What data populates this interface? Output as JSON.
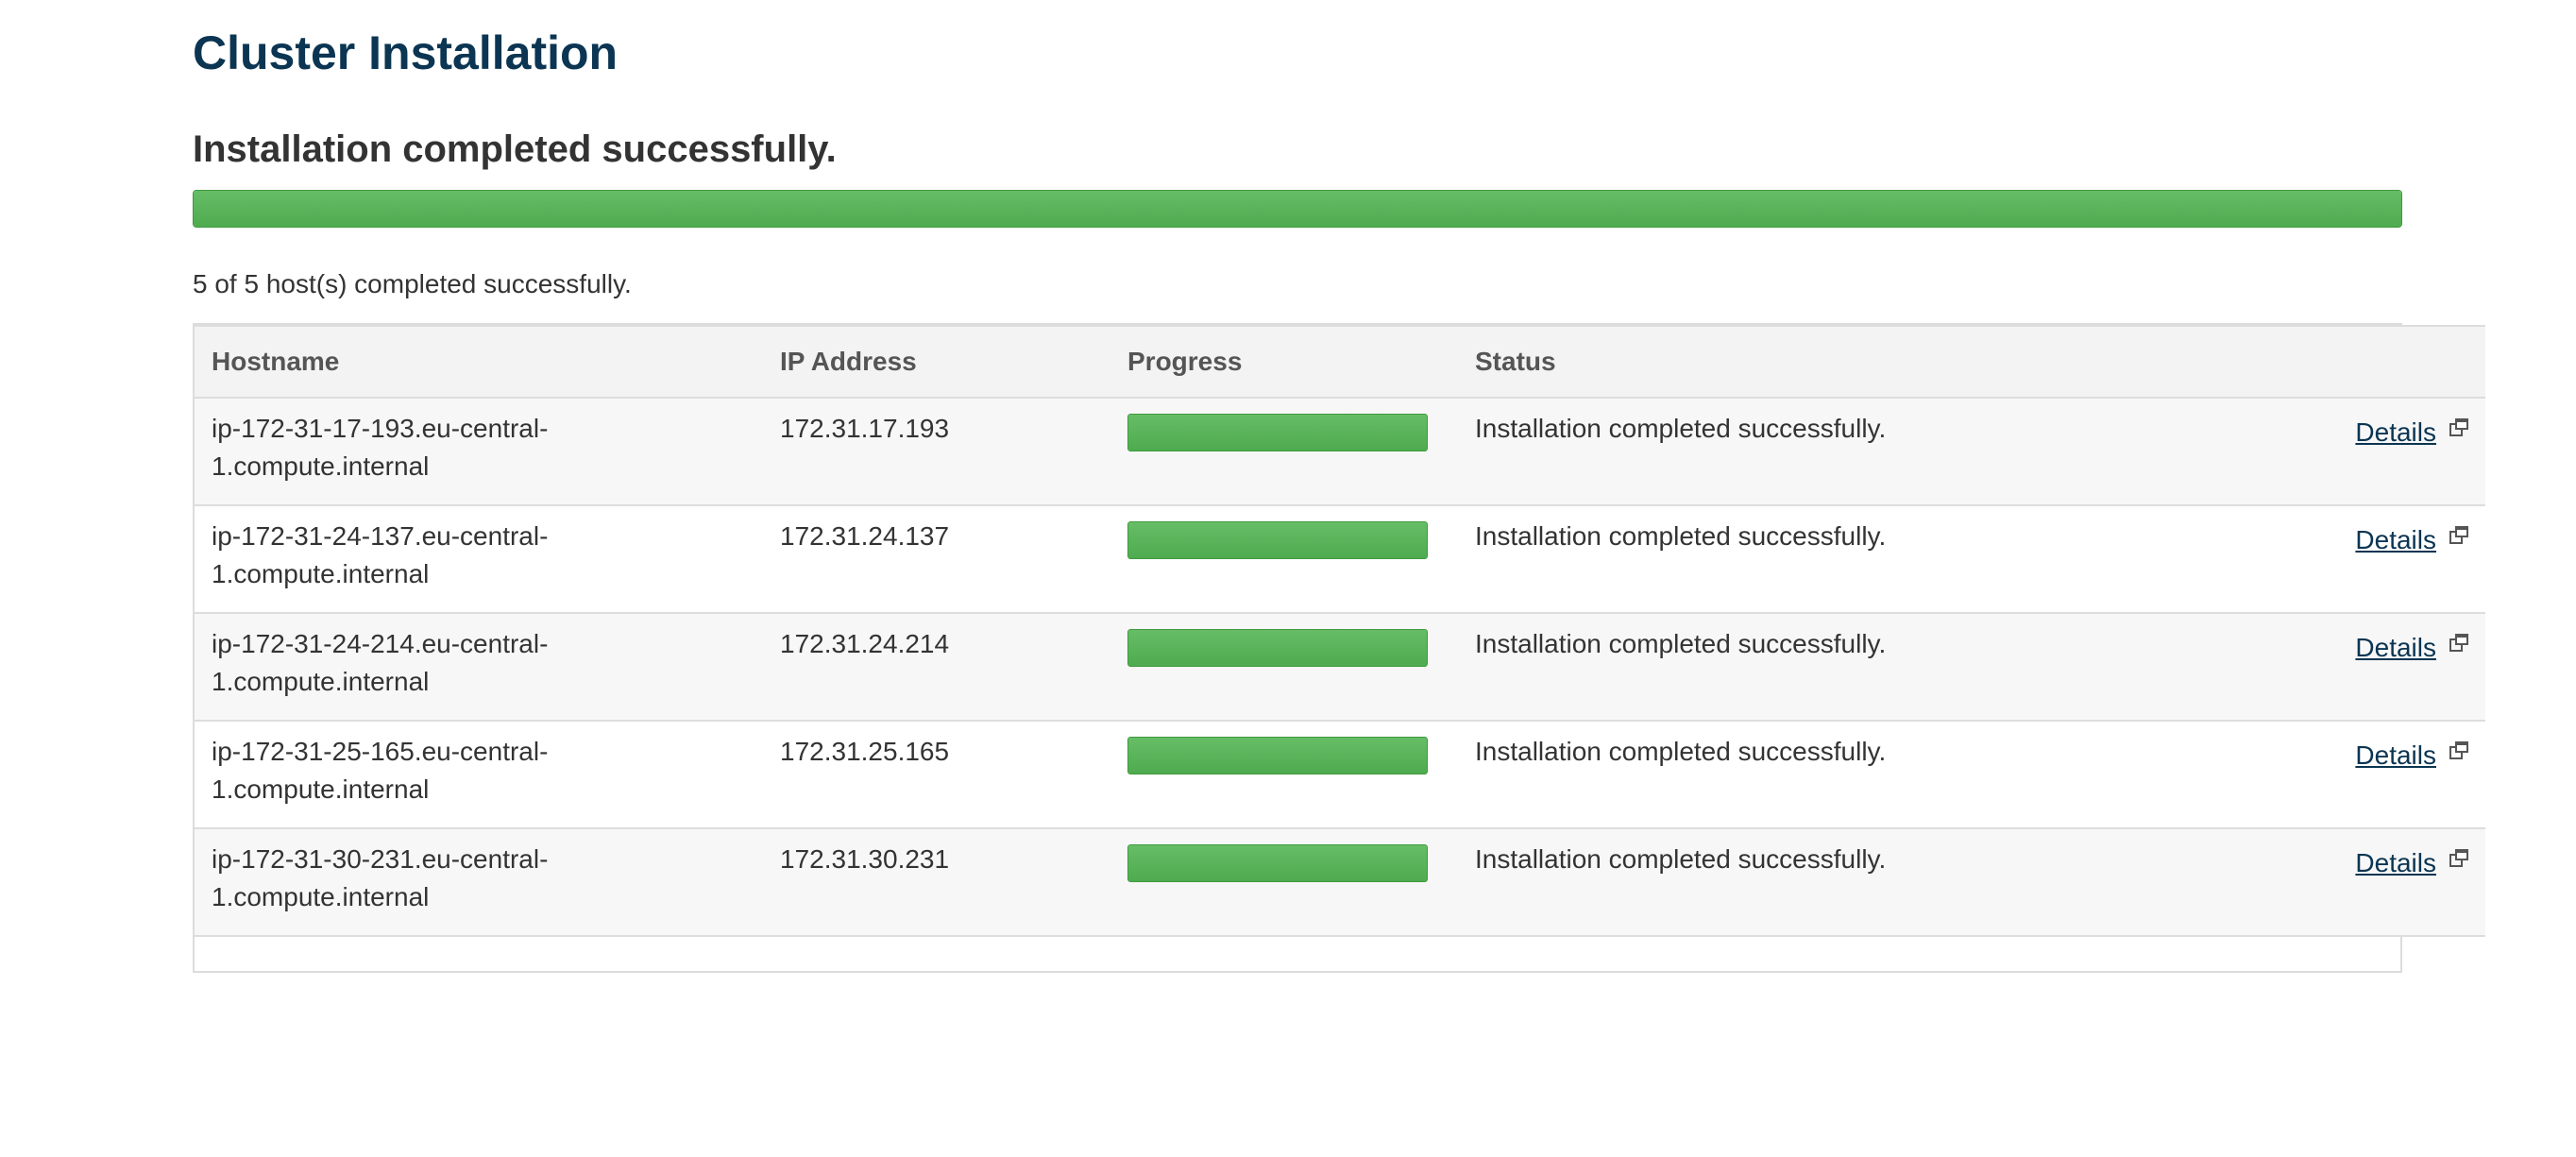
{
  "page": {
    "title": "Cluster Installation",
    "status_heading": "Installation completed successfully.",
    "overall_progress_percent": 100,
    "summary": "5 of 5 host(s) completed successfully."
  },
  "colors": {
    "title": "#0b3552",
    "progress_green": "#5cb85c",
    "link": "#0b3552"
  },
  "table": {
    "headers": {
      "hostname": "Hostname",
      "ip": "IP Address",
      "progress": "Progress",
      "status": "Status"
    },
    "rows": [
      {
        "hostname_line1": "ip-172-31-17-193.eu-central-",
        "hostname_line2": "1.compute.internal",
        "ip": "172.31.17.193",
        "progress_percent": 100,
        "status": "Installation completed successfully.",
        "link": "Details",
        "icon": "external-link-icon"
      },
      {
        "hostname_line1": "ip-172-31-24-137.eu-central-",
        "hostname_line2": "1.compute.internal",
        "ip": "172.31.24.137",
        "progress_percent": 100,
        "status": "Installation completed successfully.",
        "link": "Details",
        "icon": "external-link-icon"
      },
      {
        "hostname_line1": "ip-172-31-24-214.eu-central-",
        "hostname_line2": "1.compute.internal",
        "ip": "172.31.24.214",
        "progress_percent": 100,
        "status": "Installation completed successfully.",
        "link": "Details",
        "icon": "external-link-icon"
      },
      {
        "hostname_line1": "ip-172-31-25-165.eu-central-",
        "hostname_line2": "1.compute.internal",
        "ip": "172.31.25.165",
        "progress_percent": 100,
        "status": "Installation completed successfully.",
        "link": "Details",
        "icon": "external-link-icon"
      },
      {
        "hostname_line1": "ip-172-31-30-231.eu-central-",
        "hostname_line2": "1.compute.internal",
        "ip": "172.31.30.231",
        "progress_percent": 100,
        "status": "Installation completed successfully.",
        "link": "Details",
        "icon": "external-link-icon"
      }
    ]
  }
}
